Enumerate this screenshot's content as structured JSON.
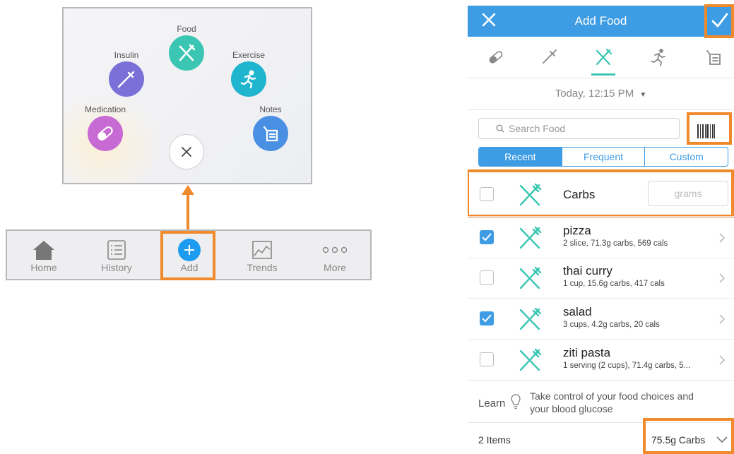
{
  "radial_menu": {
    "items": [
      {
        "label": "Food",
        "color": "#3ac6b2",
        "icon": "fork-knife-icon"
      },
      {
        "label": "Insulin",
        "color": "#7b6fd8",
        "icon": "syringe-icon"
      },
      {
        "label": "Exercise",
        "color": "#1fb5ce",
        "icon": "runner-icon"
      },
      {
        "label": "Medication",
        "color": "#c86ad3",
        "icon": "pill-icon"
      },
      {
        "label": "Notes",
        "color": "#4a90e2",
        "icon": "notes-icon"
      }
    ],
    "close_icon": "close-icon"
  },
  "tab_bar": {
    "tabs": [
      {
        "label": "Home",
        "icon": "home-icon"
      },
      {
        "label": "History",
        "icon": "list-icon"
      },
      {
        "label": "Add",
        "icon": "plus-icon",
        "active": true
      },
      {
        "label": "Trends",
        "icon": "chart-icon"
      },
      {
        "label": "More",
        "icon": "more-icon"
      }
    ]
  },
  "add_food": {
    "header": {
      "title": "Add Food",
      "close_icon": "close-icon",
      "confirm_icon": "checkmark-icon"
    },
    "entry_types": [
      {
        "icon": "pill-icon"
      },
      {
        "icon": "syringe-icon"
      },
      {
        "icon": "fork-knife-icon",
        "selected": true
      },
      {
        "icon": "runner-icon"
      },
      {
        "icon": "notes-icon"
      }
    ],
    "date": "Today, 12:15 PM",
    "search": {
      "placeholder": "Search Food",
      "barcode_icon": "barcode-icon"
    },
    "segments": [
      {
        "label": "Recent",
        "selected": true
      },
      {
        "label": "Frequent",
        "selected": false
      },
      {
        "label": "Custom",
        "selected": false
      }
    ],
    "carbs_row": {
      "label": "Carbs",
      "placeholder": "grams",
      "checked": false
    },
    "foods": [
      {
        "name": "pizza",
        "detail": "2 slice, 71.3g carbs, 569 cals",
        "checked": true
      },
      {
        "name": "thai curry",
        "detail": "1 cup, 15.6g carbs, 417 cals",
        "checked": false
      },
      {
        "name": "salad",
        "detail": "3 cups, 4.2g carbs, 20 cals",
        "checked": true
      },
      {
        "name": "ziti pasta",
        "detail": "1 serving (2 cups), 71.4g carbs, 5...",
        "checked": false
      }
    ],
    "learn": {
      "label": "Learn",
      "text_line1": "Take control of your food choices and",
      "text_line2": "your blood glucose"
    },
    "footer": {
      "count": "2 Items",
      "total": "75.5g Carbs"
    }
  },
  "colors": {
    "accent": "#3d9ce4",
    "highlight": "#f08a2c",
    "food_teal": "#3ac6b2"
  }
}
